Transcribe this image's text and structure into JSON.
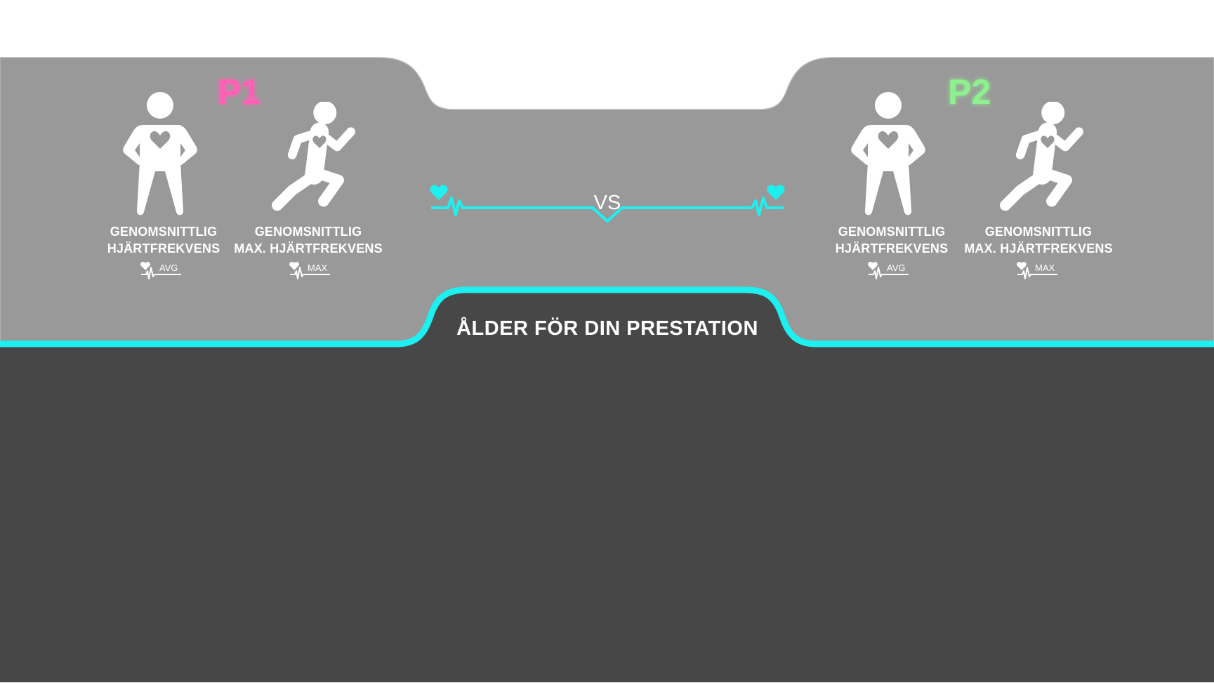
{
  "colors": {
    "panel": "#999999",
    "bottom_panel": "#474747",
    "accent_cyan": "#1ef0f0",
    "p1_pink": "#ff5fb4",
    "p2_green": "#8ff08f",
    "text": "#ffffff"
  },
  "header": {
    "vs": "VS",
    "section_title": "ÅLDER FÖR DIN PRESTATION"
  },
  "players": [
    {
      "tag": "P1",
      "tag_color": "#ff5fb4",
      "stats": [
        {
          "icon": "standing-person-heart-icon",
          "line1": "GENOMSNITTLIG",
          "line2": "HJÄRTFREKVENS",
          "badge": "AVG"
        },
        {
          "icon": "running-person-heart-icon",
          "line1": "GENOMSNITTLIG",
          "line2": "MAX. HJÄRTFREKVENS",
          "badge": "MAX"
        }
      ]
    },
    {
      "tag": "P2",
      "tag_color": "#8ff08f",
      "stats": [
        {
          "icon": "standing-person-heart-icon",
          "line1": "GENOMSNITTLIG",
          "line2": "HJÄRTFREKVENS",
          "badge": "AVG"
        },
        {
          "icon": "running-person-heart-icon",
          "line1": "GENOMSNITTLIG",
          "line2": "MAX. HJÄRTFREKVENS",
          "badge": "MAX"
        }
      ]
    }
  ]
}
